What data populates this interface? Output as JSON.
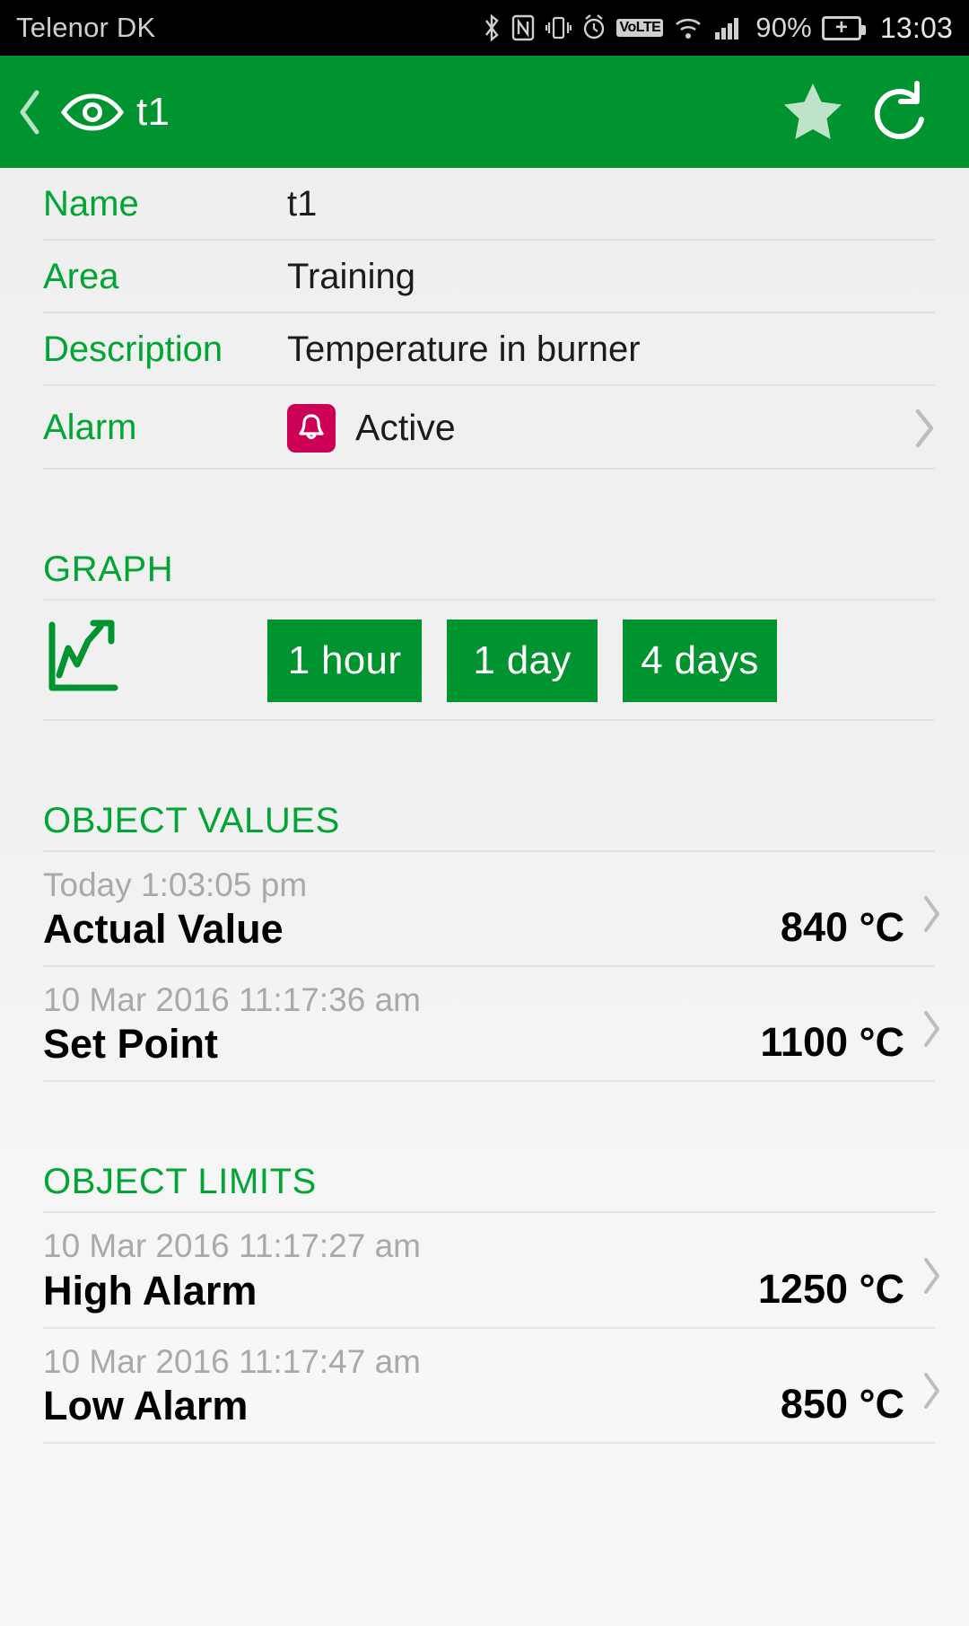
{
  "statusbar": {
    "carrier": "Telenor DK",
    "battery_percent": "90%",
    "time": "13:03",
    "volte_label": "VoLTE",
    "icons": [
      "bluetooth-icon",
      "nfc-icon",
      "vibrate-icon",
      "alarm-clock-icon",
      "volte-icon",
      "wifi-icon",
      "signal-icon",
      "battery-charging-icon"
    ]
  },
  "appbar": {
    "title": "t1",
    "back_icon": "back-chevron-icon",
    "eye_icon": "eye-icon",
    "favorite_icon": "star-icon",
    "refresh_icon": "refresh-icon"
  },
  "info_rows": [
    {
      "label": "Name",
      "value": "t1"
    },
    {
      "label": "Area",
      "value": "Training"
    },
    {
      "label": "Description",
      "value": "Temperature in burner"
    }
  ],
  "alarm_row": {
    "label": "Alarm",
    "status": "Active",
    "badge_icon": "bell-icon",
    "badge_color": "#cc0055"
  },
  "graph_section": {
    "title": "GRAPH",
    "icon": "trend-chart-icon",
    "buttons": [
      {
        "label": "1 hour"
      },
      {
        "label": "1 day"
      },
      {
        "label": "4 days"
      }
    ]
  },
  "object_values": {
    "title": "OBJECT VALUES",
    "rows": [
      {
        "timestamp": "Today 1:03:05 pm",
        "name": "Actual Value",
        "value": "840 °C"
      },
      {
        "timestamp": "10 Mar 2016 11:17:36 am",
        "name": "Set Point",
        "value": "1100 °C"
      }
    ]
  },
  "object_limits": {
    "title": "OBJECT LIMITS",
    "rows": [
      {
        "timestamp": "10 Mar 2016 11:17:27 am",
        "name": "High Alarm",
        "value": "1250 °C"
      },
      {
        "timestamp": "10 Mar 2016 11:17:47 am",
        "name": "Low Alarm",
        "value": "850 °C"
      }
    ]
  },
  "colors": {
    "accent_green": "#009430",
    "label_green": "#00a533",
    "alarm_pink": "#cc0055",
    "background": "#f1f1f1"
  }
}
